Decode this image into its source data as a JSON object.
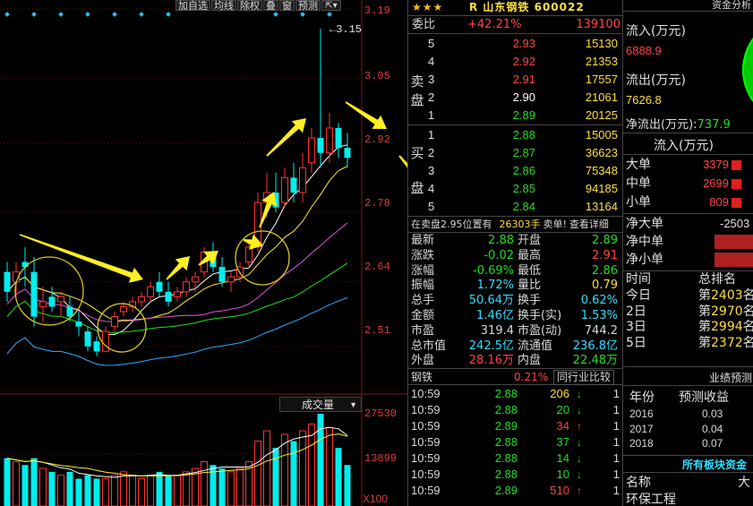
{
  "toolbar": {
    "add_watch": "加自选",
    "ma": "均线",
    "adjust": "除权",
    "overlay": "叠",
    "window": "窗",
    "forecast": "预测",
    "icon": "pin-icon"
  },
  "price_axis": {
    "labels": [
      "3.19",
      "3.05",
      "2.92",
      "2.78",
      "2.64",
      "2.51"
    ],
    "high_marker": "3.15"
  },
  "volume": {
    "label": "成交量",
    "axis_top": "27530",
    "axis_mid": "13899",
    "unit": "X100"
  },
  "chart_data": {
    "type": "candlestick",
    "ylim": [
      2.45,
      3.19
    ],
    "candles": [
      {
        "o": 2.66,
        "h": 2.68,
        "l": 2.6,
        "c": 2.62
      },
      {
        "o": 2.64,
        "h": 2.68,
        "l": 2.61,
        "c": 2.66
      },
      {
        "o": 2.68,
        "h": 2.71,
        "l": 2.63,
        "c": 2.67
      },
      {
        "o": 2.66,
        "h": 2.69,
        "l": 2.55,
        "c": 2.57
      },
      {
        "o": 2.59,
        "h": 2.63,
        "l": 2.56,
        "c": 2.6
      },
      {
        "o": 2.61,
        "h": 2.63,
        "l": 2.58,
        "c": 2.59
      },
      {
        "o": 2.6,
        "h": 2.62,
        "l": 2.57,
        "c": 2.61
      },
      {
        "o": 2.59,
        "h": 2.61,
        "l": 2.56,
        "c": 2.57
      },
      {
        "o": 2.56,
        "h": 2.58,
        "l": 2.53,
        "c": 2.55
      },
      {
        "o": 2.54,
        "h": 2.55,
        "l": 2.5,
        "c": 2.51
      },
      {
        "o": 2.52,
        "h": 2.53,
        "l": 2.49,
        "c": 2.5
      },
      {
        "o": 2.5,
        "h": 2.55,
        "l": 2.5,
        "c": 2.54
      },
      {
        "o": 2.55,
        "h": 2.58,
        "l": 2.54,
        "c": 2.57
      },
      {
        "o": 2.58,
        "h": 2.6,
        "l": 2.57,
        "c": 2.59
      },
      {
        "o": 2.59,
        "h": 2.61,
        "l": 2.58,
        "c": 2.6
      },
      {
        "o": 2.6,
        "h": 2.62,
        "l": 2.59,
        "c": 2.61
      },
      {
        "o": 2.61,
        "h": 2.64,
        "l": 2.6,
        "c": 2.63
      },
      {
        "o": 2.64,
        "h": 2.66,
        "l": 2.61,
        "c": 2.62
      },
      {
        "o": 2.62,
        "h": 2.64,
        "l": 2.59,
        "c": 2.6
      },
      {
        "o": 2.61,
        "h": 2.63,
        "l": 2.6,
        "c": 2.62
      },
      {
        "o": 2.62,
        "h": 2.65,
        "l": 2.61,
        "c": 2.64
      },
      {
        "o": 2.64,
        "h": 2.66,
        "l": 2.62,
        "c": 2.65
      },
      {
        "o": 2.66,
        "h": 2.71,
        "l": 2.65,
        "c": 2.7
      },
      {
        "o": 2.7,
        "h": 2.72,
        "l": 2.66,
        "c": 2.67
      },
      {
        "o": 2.67,
        "h": 2.69,
        "l": 2.63,
        "c": 2.64
      },
      {
        "o": 2.64,
        "h": 2.66,
        "l": 2.62,
        "c": 2.65
      },
      {
        "o": 2.65,
        "h": 2.68,
        "l": 2.64,
        "c": 2.67
      },
      {
        "o": 2.68,
        "h": 2.72,
        "l": 2.67,
        "c": 2.71
      },
      {
        "o": 2.71,
        "h": 2.82,
        "l": 2.7,
        "c": 2.8
      },
      {
        "o": 2.8,
        "h": 2.86,
        "l": 2.77,
        "c": 2.82
      },
      {
        "o": 2.82,
        "h": 2.86,
        "l": 2.78,
        "c": 2.79
      },
      {
        "o": 2.8,
        "h": 2.87,
        "l": 2.79,
        "c": 2.85
      },
      {
        "o": 2.85,
        "h": 2.88,
        "l": 2.8,
        "c": 2.82
      },
      {
        "o": 2.82,
        "h": 2.9,
        "l": 2.8,
        "c": 2.87
      },
      {
        "o": 2.88,
        "h": 2.95,
        "l": 2.86,
        "c": 2.93
      },
      {
        "o": 2.93,
        "h": 3.15,
        "l": 2.87,
        "c": 2.9
      },
      {
        "o": 2.9,
        "h": 2.98,
        "l": 2.88,
        "c": 2.95
      },
      {
        "o": 2.95,
        "h": 2.96,
        "l": 2.89,
        "c": 2.91
      },
      {
        "o": 2.91,
        "h": 2.94,
        "l": 2.87,
        "c": 2.89
      }
    ],
    "volume": [
      14,
      13,
      12,
      14,
      11,
      10,
      9,
      10,
      8,
      9,
      8,
      8,
      9,
      10,
      9,
      8,
      9,
      10,
      9,
      9,
      10,
      11,
      13,
      12,
      11,
      10,
      11,
      13,
      19,
      22,
      17,
      21,
      19,
      22,
      24,
      27,
      23,
      17,
      12
    ],
    "vol_ylim": [
      0,
      27530
    ]
  },
  "quote": {
    "stars": "★★★",
    "name": "R 山东钢铁 600022",
    "weibi_label": "委比",
    "weibi_pct": "+42.21%",
    "weibi_diff": "139100",
    "sell_label": "卖盘",
    "buy_label": "买盘",
    "sells": [
      {
        "n": "5",
        "p": "2.93",
        "v": "15130",
        "c": "#ff4444"
      },
      {
        "n": "4",
        "p": "2.92",
        "v": "21353",
        "c": "#ff4444"
      },
      {
        "n": "3",
        "p": "2.91",
        "v": "17557",
        "c": "#ff4444"
      },
      {
        "n": "2",
        "p": "2.90",
        "v": "21061",
        "c": "#ffffff"
      },
      {
        "n": "1",
        "p": "2.89",
        "v": "20125",
        "c": "#22dd22"
      }
    ],
    "buys": [
      {
        "n": "1",
        "p": "2.88",
        "v": "15005",
        "c": "#22dd22"
      },
      {
        "n": "2",
        "p": "2.87",
        "v": "36623",
        "c": "#22dd22"
      },
      {
        "n": "3",
        "p": "2.86",
        "v": "75348",
        "c": "#22dd22"
      },
      {
        "n": "4",
        "p": "2.85",
        "v": "94185",
        "c": "#22dd22"
      },
      {
        "n": "5",
        "p": "2.84",
        "v": "13164",
        "c": "#22dd22"
      }
    ],
    "hang": {
      "a": "在卖盘2.95位置有",
      "b": "26303手",
      "c": "卖单!",
      "d": "查看详细"
    },
    "stats": [
      {
        "k1": "最新",
        "v1": "2.88",
        "c1": "#22dd22",
        "k2": "开盘",
        "v2": "2.89",
        "c2": "#22dd22"
      },
      {
        "k1": "涨跌",
        "v1": "-0.02",
        "c1": "#22dd22",
        "k2": "最高",
        "v2": "2.91",
        "c2": "#ff4444"
      },
      {
        "k1": "涨幅",
        "v1": "-0.69%",
        "c1": "#22dd22",
        "k2": "最低",
        "v2": "2.86",
        "c2": "#22dd22"
      },
      {
        "k1": "振幅",
        "v1": "1.72%",
        "c1": "#33ddff",
        "k2": "量比",
        "v2": "0.79",
        "c2": "#ffdf3a"
      },
      {
        "k1": "总手",
        "v1": "50.64万",
        "c1": "#33ddff",
        "k2": "换手",
        "v2": "0.62%",
        "c2": "#33ddff"
      },
      {
        "k1": "金额",
        "v1": "1.46亿",
        "c1": "#33ddff",
        "k2": "换手(实)",
        "v2": "1.53%",
        "c2": "#33ddff"
      },
      {
        "k1": "市盈",
        "v1": "319.4",
        "c1": "#d8d8d8",
        "k2": "市盈(动)",
        "v2": "744.2",
        "c2": "#d8d8d8"
      },
      {
        "k1": "总市值",
        "v1": "242.5亿",
        "c1": "#33ddff",
        "k2": "流通值",
        "v2": "236.8亿",
        "c2": "#33ddff"
      },
      {
        "k1": "外盘",
        "v1": "28.16万",
        "c1": "#ff4444",
        "k2": "内盘",
        "v2": "22.48万",
        "c2": "#22dd22"
      }
    ],
    "industry": {
      "name": "钢铁",
      "pct": "0.21%",
      "btn": "同行业比较"
    },
    "ticks": [
      {
        "t": "10:59",
        "p": "2.88",
        "pc": "#22dd22",
        "q": "206",
        "qc": "#ffdf3a",
        "dir": "down",
        "f": "1"
      },
      {
        "t": "10:59",
        "p": "2.88",
        "pc": "#22dd22",
        "q": "20",
        "qc": "#22dd22",
        "dir": "down",
        "f": "1"
      },
      {
        "t": "10:59",
        "p": "2.89",
        "pc": "#22dd22",
        "q": "34",
        "qc": "#ff4444",
        "dir": "up",
        "f": "1"
      },
      {
        "t": "10:59",
        "p": "2.88",
        "pc": "#22dd22",
        "q": "37",
        "qc": "#22dd22",
        "dir": "down",
        "f": "1"
      },
      {
        "t": "10:59",
        "p": "2.88",
        "pc": "#22dd22",
        "q": "14",
        "qc": "#22dd22",
        "dir": "down",
        "f": "1"
      },
      {
        "t": "10:59",
        "p": "2.88",
        "pc": "#22dd22",
        "q": "10",
        "qc": "#22dd22",
        "dir": "down",
        "f": "1"
      },
      {
        "t": "10:59",
        "p": "2.89",
        "pc": "#22dd22",
        "q": "510",
        "qc": "#ff4444",
        "dir": "up",
        "f": "1"
      }
    ]
  },
  "fund": {
    "header": "资金分析",
    "inflow_label": "流入(万元)",
    "inflow": "6888.9",
    "outflow_label": "流出(万元)",
    "outflow": "7626.8",
    "net_label": "净流出(万元):",
    "net": "737.9",
    "flow_header": "流入(万元)",
    "orders": [
      {
        "l": "大单",
        "v": "3379"
      },
      {
        "l": "中单",
        "v": "2699"
      },
      {
        "l": "小单",
        "v": "809"
      }
    ],
    "net_rows": [
      {
        "l": "净大单",
        "v": "-2503"
      },
      {
        "l": "净中单",
        "v": ""
      },
      {
        "l": "净小单",
        "v": ""
      }
    ],
    "rank_head_l": "时间",
    "rank_head_r": "总排名",
    "ranks": [
      {
        "l": "今日",
        "a": "第",
        "n": "2403",
        "b": "名"
      },
      {
        "l": "2日",
        "a": "第",
        "n": "2970",
        "b": "名"
      },
      {
        "l": "3日",
        "a": "第",
        "n": "2994",
        "b": "名"
      },
      {
        "l": "5日",
        "a": "第",
        "n": "2372",
        "b": "名"
      }
    ],
    "yj_title": "业绩预测",
    "yj_head_l": "年份",
    "yj_head_r": "预测收益",
    "yj": [
      {
        "l": "2016",
        "v": "0.03"
      },
      {
        "l": "2017",
        "v": "0.04"
      },
      {
        "l": "2018",
        "v": "0.07"
      }
    ],
    "blocks_title": "所有板块资金",
    "blocks_head_l": "名称",
    "blocks_head_r": "大",
    "blocks_first": "环保工程"
  }
}
